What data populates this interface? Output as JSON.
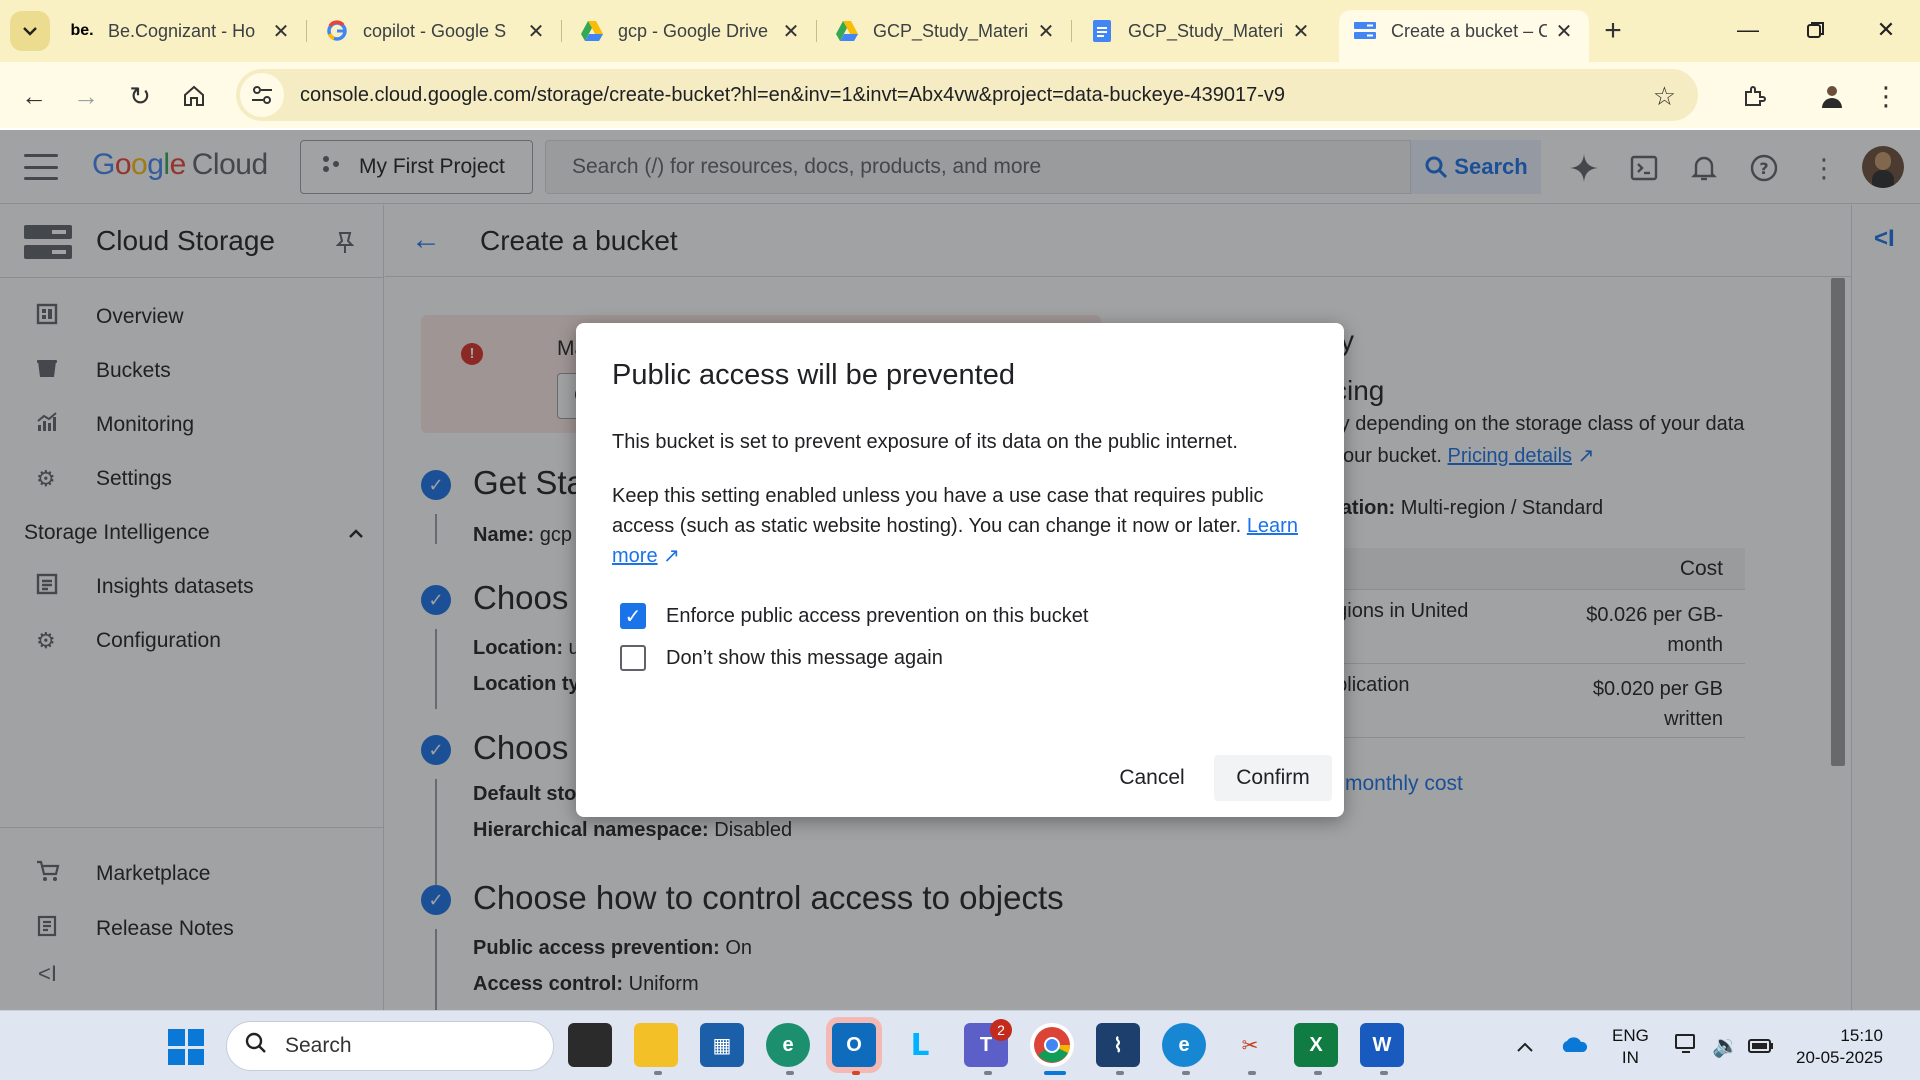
{
  "browser": {
    "tabs": [
      {
        "favicon": "cognizant-icon",
        "title": "Be.Cognizant - Ho"
      },
      {
        "favicon": "google-icon",
        "title": "copilot - Google S"
      },
      {
        "favicon": "drive-icon",
        "title": "gcp - Google Drive"
      },
      {
        "favicon": "drive-icon",
        "title": "GCP_Study_Materi"
      },
      {
        "favicon": "docs-icon",
        "title": "GCP_Study_Materi"
      },
      {
        "favicon": "storage-icon",
        "title": "Create a bucket – C"
      }
    ],
    "active_tab": 5,
    "url": "console.cloud.google.com/storage/create-bucket?hl=en&inv=1&invt=Abx4vw&project=data-buckeye-439017-v9",
    "accent_color": "#f9f0c4"
  },
  "gcp_header": {
    "logo_google": "Google",
    "logo_cloud": "Cloud",
    "project": "My First Project",
    "search_placeholder": "Search (/) for resources, docs, products, and more",
    "search_button": "Search"
  },
  "sidebar": {
    "title": "Cloud Storage",
    "items": [
      {
        "icon": "dashboard-icon",
        "label": "Overview"
      },
      {
        "icon": "bucket-icon",
        "label": "Buckets"
      },
      {
        "icon": "monitoring-icon",
        "label": "Monitoring"
      },
      {
        "icon": "gear-icon",
        "label": "Settings"
      }
    ],
    "section": "Storage Intelligence",
    "section_items": [
      {
        "icon": "dataset-icon",
        "label": "Insights datasets"
      },
      {
        "icon": "gear-icon",
        "label": "Configuration"
      }
    ],
    "bottom_items": [
      {
        "icon": "cart-icon",
        "label": "Marketplace"
      },
      {
        "icon": "notes-icon",
        "label": "Release Notes"
      }
    ]
  },
  "page": {
    "title": "Create a bucket",
    "alert_text": "Make",
    "alert_button": "Go",
    "steps": [
      {
        "heading": "Get Sta",
        "rows": [
          {
            "k": "Name:",
            "v": " gcp"
          }
        ]
      },
      {
        "heading": "Choos",
        "rows": [
          {
            "k": "Location:",
            "v": " u"
          },
          {
            "k": "Location ty",
            "v": ""
          }
        ]
      },
      {
        "heading": "Choos",
        "rows": [
          {
            "k": "Default sto",
            "v": ""
          },
          {
            "k": "Hierarchical namespace:",
            "v": " Disabled"
          }
        ]
      },
      {
        "heading": "Choose how to control access to objects",
        "rows": [
          {
            "k": "Public access prevention:",
            "v": " On"
          },
          {
            "k": "Access control:",
            "v": " Uniform"
          }
        ]
      }
    ],
    "right_panel": {
      "heading_fragment": "y",
      "pricing_heading": "cing",
      "line1": "ry depending on the storage class of your data",
      "line2_prefix": "your bucket. ",
      "pricing_link": "Pricing details",
      "config_label": "ration:",
      "config_value": " Multi-region / Standard",
      "cost_header": "Cost",
      "rows": [
        {
          "item": "egions in United",
          "cost_line1": "$0.026 per GB-",
          "cost_line2": "month"
        },
        {
          "item": "eplication",
          "cost_line1": "$0.020 per GB",
          "cost_line2": "written"
        }
      ],
      "estimate_link": "monthly cost"
    }
  },
  "dialog": {
    "title": "Public access will be prevented",
    "para1": "This bucket is set to prevent exposure of its data on the public internet.",
    "para2": "Keep this setting enabled unless you have a use case that requires public access (such as static website hosting). You can change it now or later.",
    "learn_more": "Learn more",
    "checkbox1": {
      "label": "Enforce public access prevention on this bucket",
      "checked": true
    },
    "checkbox2": {
      "label": "Don’t show this message again",
      "checked": false
    },
    "cancel": "Cancel",
    "confirm": "Confirm"
  },
  "taskbar": {
    "search_placeholder": "Search",
    "teams_badge": "2",
    "lang_line1": "ENG",
    "lang_line2": "IN",
    "time": "15:10",
    "date": "20-05-2025"
  }
}
